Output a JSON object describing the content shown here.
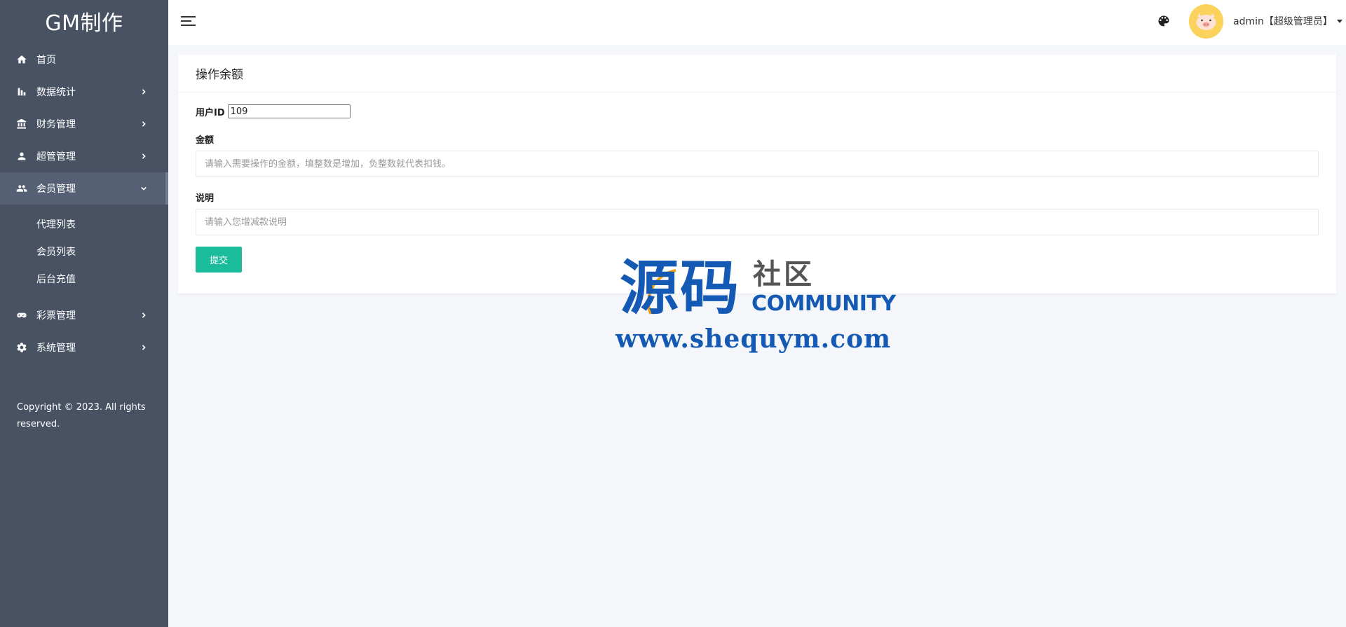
{
  "sidebar": {
    "brand": "GM制作",
    "items": [
      {
        "label": "首页",
        "icon": "home-icon",
        "has_chevron": false
      },
      {
        "label": "数据统计",
        "icon": "bar-chart-icon",
        "has_chevron": true
      },
      {
        "label": "财务管理",
        "icon": "bank-icon",
        "has_chevron": true
      },
      {
        "label": "超管管理",
        "icon": "person-icon",
        "has_chevron": true
      },
      {
        "label": "会员管理",
        "icon": "group-icon",
        "has_chevron": true,
        "expanded": true
      },
      {
        "label": "彩票管理",
        "icon": "gamepad-icon",
        "has_chevron": true
      },
      {
        "label": "系统管理",
        "icon": "gear-icon",
        "has_chevron": true
      }
    ],
    "submenu": [
      "代理列表",
      "会员列表",
      "后台充值"
    ],
    "copyright": "Copyright © 2023. All rights reserved."
  },
  "header": {
    "user_label": "admin【超级管理员】"
  },
  "card": {
    "title": "操作余额",
    "user_id_label": "用户ID",
    "user_id_value": "109",
    "amount_label": "金额",
    "amount_placeholder": "请输入需要操作的金额，填整数是增加，负整数就代表扣钱。",
    "note_label": "说明",
    "note_placeholder": "请输入您增减款说明",
    "submit_label": "提交"
  },
  "watermark": {
    "cn_main": "源码",
    "cn_sub": "社区",
    "en": "COMMUNITY",
    "url": "www.shequym.com"
  },
  "colors": {
    "sidebar_bg": "#485263",
    "sidebar_active": "#566074",
    "accent": "#1abc9c",
    "avatar_bg": "#fbd35c",
    "watermark_blue": "#1459b3"
  }
}
